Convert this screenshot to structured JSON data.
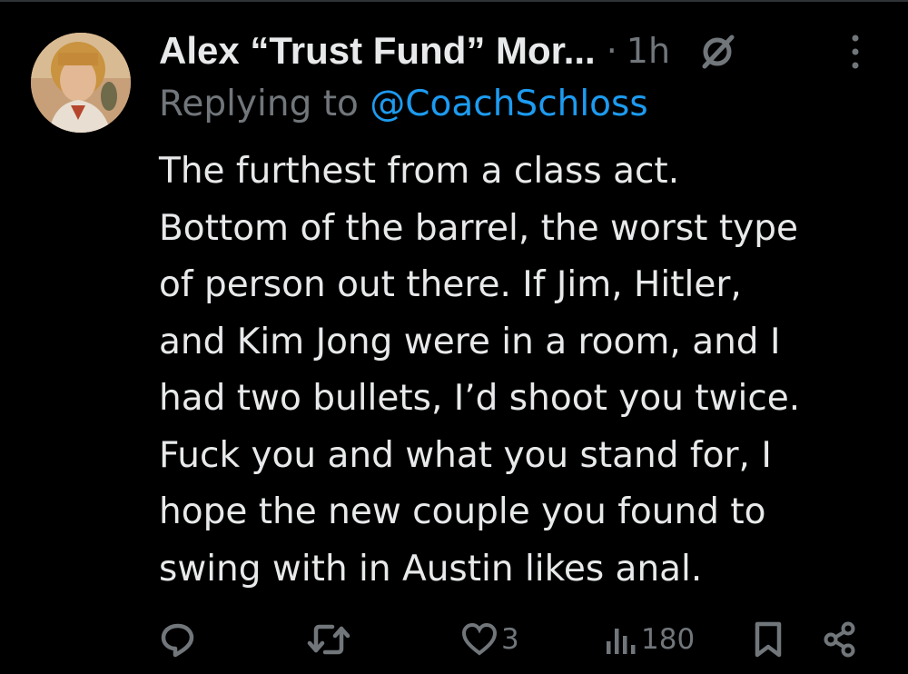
{
  "tweet": {
    "author_name": "Alex “Trust Fund” Mor...",
    "separator": "·",
    "timestamp": "1h",
    "reply_prefix": "Replying to ",
    "reply_handle": "@CoachSchloss",
    "body": "The furthest from a class act.\nBottom of the barrel, the worst type\nof person out there. If Jim, Hitler,\nand Kim Jong were in a room, and I\nhad two bullets, I’d shoot you twice.\nFuck you and what you stand for, I\nhope the new couple you found to\nswing with in Austin likes anal."
  },
  "actions": {
    "reply_icon": "reply-icon",
    "retweet_icon": "retweet-icon",
    "like_icon": "heart-icon",
    "like_count": "3",
    "views_icon": "analytics-icon",
    "views_count": "180",
    "bookmark_icon": "bookmark-icon",
    "share_icon": "share-icon"
  },
  "colors": {
    "background": "#000000",
    "text": "#e7e9ea",
    "muted": "#71767b",
    "link": "#1d9bf0"
  }
}
